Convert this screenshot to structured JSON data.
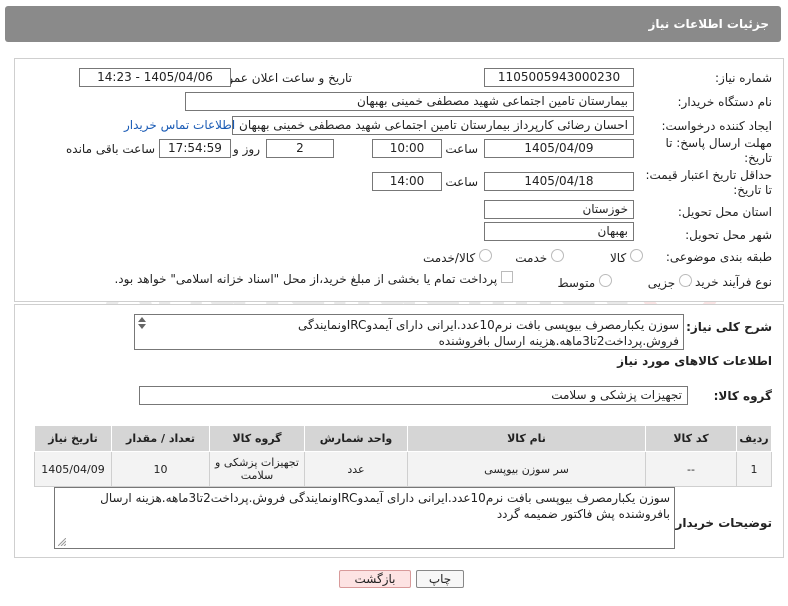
{
  "header": {
    "title": "جزئیات اطلاعات نیاز"
  },
  "fields": {
    "need_number_label": "شماره نیاز:",
    "need_number": "1105005943000230",
    "announce_label": "تاریخ و ساعت اعلان عمومی:",
    "announce_value": "1405/04/06 - 14:23",
    "buyer_org_label": "نام دستگاه خریدار:",
    "buyer_org": "بیمارستان تامین اجتماعی شهید مصطفی خمینی بهبهان",
    "requester_label": "ایجاد کننده درخواست:",
    "requester": "احسان رضائی کارپرداز بیمارستان تامین اجتماعی شهید مصطفی خمینی بهبهان",
    "contact_link": "اطلاعات تماس خریدار",
    "deadline_label_1": "مهلت ارسال پاسخ: تا",
    "deadline_label_2": "تاریخ:",
    "deadline_date": "1405/04/09",
    "time_label": "ساعت",
    "deadline_time": "10:00",
    "days": "2",
    "days_label": "روز و",
    "remaining_time": "17:54:59",
    "remaining_label": "ساعت باقی مانده",
    "validity_label_1": "حداقل تاریخ اعتبار قیمت:",
    "validity_label_2": "تا تاریخ:",
    "validity_date": "1405/04/18",
    "validity_time": "14:00",
    "province_label": "استان محل تحویل:",
    "province": "خوزستان",
    "city_label": "شهر محل تحویل:",
    "city": "بهبهان",
    "category_label": "طبقه بندی موضوعی:",
    "category_options": [
      "کالا",
      "خدمت",
      "کالا/خدمت"
    ],
    "process_label": "نوع فرآیند خرید :",
    "process_options": [
      "جزیی",
      "متوسط"
    ],
    "payment_note": "پرداخت تمام یا بخشی از مبلغ خرید،از محل \"اسناد خزانه اسلامی\" خواهد بود."
  },
  "description": {
    "label": "شرح کلی نیاز:",
    "text": "سوزن یکبارمصرف بیوپسی بافت نرم10عدد.ایرانی دارای آیمدوIRCونمایندگی فروش.پرداخت2تا3ماهه.هزینه ارسال بافروشنده"
  },
  "goods_section": {
    "title": "اطلاعات کالاهای مورد نیاز",
    "group_label": "گروه کالا:",
    "group_value": "تجهیزات پزشکی و سلامت"
  },
  "table": {
    "headers": [
      "ردیف",
      "کد کالا",
      "نام کالا",
      "واحد شمارش",
      "گروه کالا",
      "تعداد / مقدار",
      "تاریخ نیاز"
    ],
    "rows": [
      [
        "1",
        "--",
        "سر سوزن بیوپسی",
        "عدد",
        "تجهیزات پزشکی و سلامت",
        "10",
        "1405/04/09"
      ]
    ]
  },
  "buyer_notes": {
    "label": "توضیحات خریدار:",
    "text": "سوزن یکبارمصرف بیوپسی بافت نرم10عدد.ایرانی دارای آیمدوIRCونمایندگی فروش.پرداخت2تا3ماهه.هزینه ارسال بافروشنده پش فاکتور ضمیمه گردد"
  },
  "buttons": {
    "print": "چاپ",
    "back": "بازگشت"
  },
  "watermark": "AriaTender.net",
  "colors": {
    "header_bg": "#8a8a8a",
    "link": "#1a5bb5",
    "back_button": "#fde3e3"
  }
}
